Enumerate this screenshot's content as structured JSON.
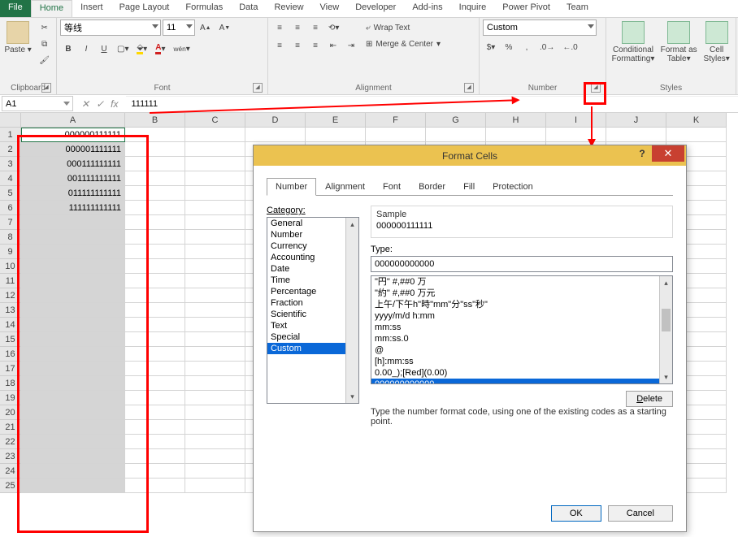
{
  "tabs": [
    "File",
    "Home",
    "Insert",
    "Page Layout",
    "Formulas",
    "Data",
    "Review",
    "View",
    "Developer",
    "Add-ins",
    "Inquire",
    "Power Pivot",
    "Team"
  ],
  "active_tab": "Home",
  "groups": {
    "clipboard": "Clipboard",
    "font": "Font",
    "alignment": "Alignment",
    "number": "Number",
    "styles": "Styles"
  },
  "clipboard": {
    "paste": "Paste"
  },
  "font": {
    "name": "等线",
    "size": "11",
    "increase": "A",
    "decrease": "A",
    "bold": "B",
    "italic": "I",
    "underline": "U"
  },
  "alignment": {
    "wrap": "Wrap Text",
    "merge": "Merge & Center"
  },
  "number": {
    "format": "Custom",
    "pct": "%",
    "comma": ","
  },
  "styles": {
    "cond": "Conditional Formatting",
    "table": "Format as Table",
    "cell": "Cell Styles"
  },
  "namebox": "A1",
  "formula": "111111",
  "columns": [
    "A",
    "B",
    "C",
    "K"
  ],
  "col_widths": {
    "A": 128,
    "B": 74,
    "C": 74,
    "D": 74,
    "E": 74,
    "F": 74,
    "G": 74,
    "H": 74,
    "I": 74,
    "J": 74,
    "K": 74
  },
  "rows": 25,
  "cells": {
    "A1": "000000111111",
    "A2": "000001111111",
    "A3": "000111111111",
    "A4": "001111111111",
    "A5": "011111111111",
    "A6": "111111111111"
  },
  "dialog": {
    "title": "Format Cells",
    "tabs": [
      "Number",
      "Alignment",
      "Font",
      "Border",
      "Fill",
      "Protection"
    ],
    "active_tab": "Number",
    "category_label": "Category:",
    "categories": [
      "General",
      "Number",
      "Currency",
      "Accounting",
      "Date",
      "Time",
      "Percentage",
      "Fraction",
      "Scientific",
      "Text",
      "Special",
      "Custom"
    ],
    "selected_category": "Custom",
    "sample_label": "Sample",
    "sample_value": "000000111111",
    "type_label": "Type:",
    "type_value": "000000000000",
    "format_list": [
      "\"円\" #,##0 万",
      "\"約\" #,##0 万元",
      "上午/下午h\"時\"mm\"分\"ss\"秒\"",
      "yyyy/m/d h:mm",
      "mm:ss",
      "mm:ss.0",
      "@",
      "[h]:mm:ss",
      "0.00_);[Red](0.00)",
      "000000000000"
    ],
    "selected_format": "000000000000",
    "delete": "Delete",
    "hint": "Type the number format code, using one of the existing codes as a starting point.",
    "ok": "OK",
    "cancel": "Cancel"
  }
}
